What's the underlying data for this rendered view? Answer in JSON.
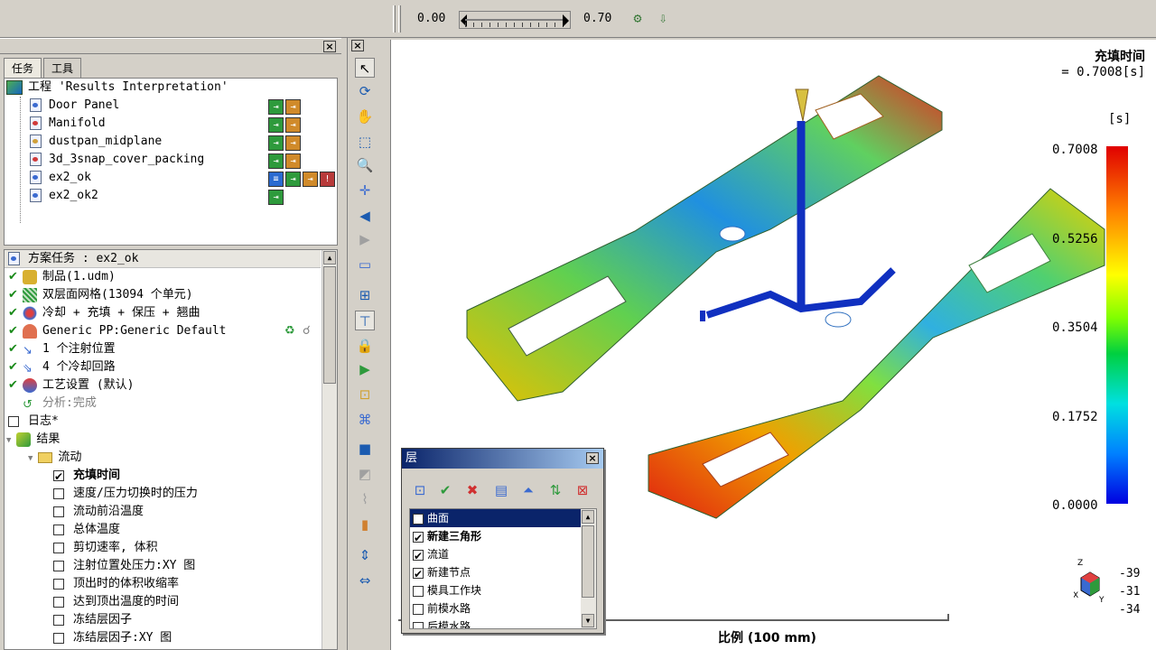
{
  "toolbar": {
    "anim_start": "0.00",
    "anim_end": "0.70"
  },
  "tabs": [
    {
      "label": "任务"
    },
    {
      "label": "工具"
    }
  ],
  "project": {
    "title": "工程 'Results Interpretation'",
    "items": [
      {
        "name": "Door Panel"
      },
      {
        "name": "Manifold"
      },
      {
        "name": "dustpan_midplane"
      },
      {
        "name": "3d_3snap_cover_packing"
      },
      {
        "name": "ex2_ok"
      },
      {
        "name": "ex2_ok2"
      }
    ]
  },
  "study": {
    "header": "方案任务 : ex2_ok",
    "tasks": [
      {
        "label": "制品(1.udm)"
      },
      {
        "label": "双层面网格(13094 个单元)"
      },
      {
        "label": "冷却 + 充填 + 保压 + 翘曲"
      },
      {
        "label": "Generic PP:Generic Default"
      },
      {
        "label": "1 个注射位置"
      },
      {
        "label": "4 个冷却回路"
      },
      {
        "label": "工艺设置 (默认)"
      },
      {
        "label": "分析:完成"
      }
    ],
    "log": "日志*",
    "results": "结果",
    "flow": "流动",
    "result_items": [
      {
        "label": "充填时间",
        "checked": true
      },
      {
        "label": "速度/压力切换时的压力",
        "checked": false
      },
      {
        "label": "流动前沿温度",
        "checked": false
      },
      {
        "label": "总体温度",
        "checked": false
      },
      {
        "label": "剪切速率, 体积",
        "checked": false
      },
      {
        "label": "注射位置处压力:XY 图",
        "checked": false
      },
      {
        "label": "顶出时的体积收缩率",
        "checked": false
      },
      {
        "label": "达到顶出温度的时间",
        "checked": false
      },
      {
        "label": "冻结层因子",
        "checked": false
      },
      {
        "label": "冻结层因子:XY 图",
        "checked": false
      }
    ]
  },
  "viewport": {
    "title": "充填时间",
    "value": "= 0.7008[s]",
    "unit": "[s]",
    "legend": [
      "0.7008",
      "0.5256",
      "0.3504",
      "0.1752",
      "0.0000"
    ],
    "scale": "比例 (100 mm)",
    "orientation": [
      "-39",
      "-31",
      "-34"
    ]
  },
  "layers": {
    "title": "层",
    "items": [
      {
        "label": "曲面",
        "checked": false
      },
      {
        "label": "新建三角形",
        "checked": true
      },
      {
        "label": "流道",
        "checked": true
      },
      {
        "label": "新建节点",
        "checked": true
      },
      {
        "label": "模具工作块",
        "checked": false
      },
      {
        "label": "前模水路",
        "checked": false
      },
      {
        "label": "后模水路",
        "checked": false
      }
    ]
  }
}
